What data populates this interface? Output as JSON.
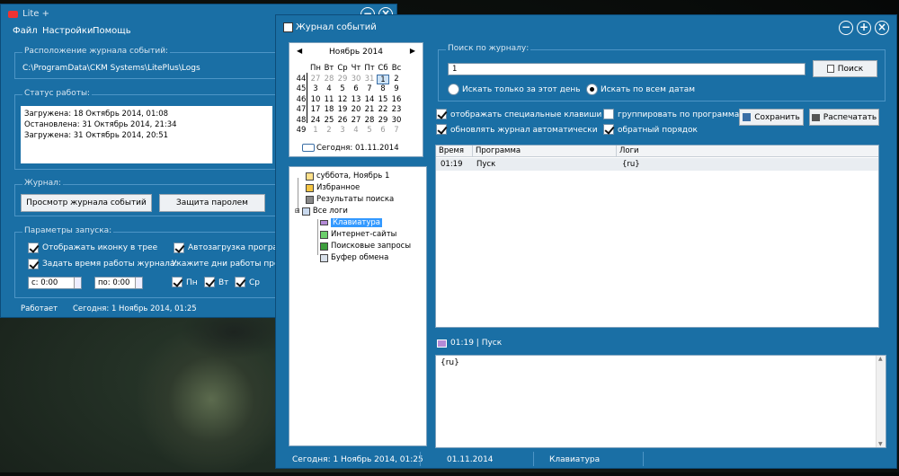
{
  "lite": {
    "title": "Lite +",
    "menu": [
      "Файл",
      "Настройки",
      "Помощь"
    ],
    "log_location_label": "Расположение журнала событий:",
    "log_path": "C:\\ProgramData\\CKM Systems\\LitePlus\\Logs",
    "work_status_label": "Статус работы:",
    "status_lines": [
      "Загружена: 18 Октябрь 2014, 01:08",
      "Остановлена: 31 Октябрь 2014, 21:34",
      "Загружена: 31 Октябрь 2014, 20:51"
    ],
    "journal_label": "Журнал:",
    "view_log_button": "Просмотр журнала событий",
    "password_button": "Защита паролем",
    "launch_params_label": "Параметры запуска:",
    "show_tray_icon": "Отображать иконку в трее",
    "autoload_programs": "Автозагрузка программы",
    "set_journal_time": "Задать время работы журнала:",
    "specify_days": "Укажите дни работы програм",
    "time_from": "с: 0:00",
    "time_to": "по: 0:00",
    "days": [
      "Пн",
      "Вт",
      "Ср"
    ],
    "status_left": "Работает",
    "status_today": "Сегодня: 1 Ноябрь 2014, 01:25"
  },
  "journal": {
    "title": "Журнал событий",
    "calendar": {
      "month": "Ноябрь 2014",
      "weekdays": [
        "Пн",
        "Вт",
        "Ср",
        "Чт",
        "Пт",
        "Сб",
        "Вс"
      ],
      "weeks": [
        "44",
        "45",
        "46",
        "47",
        "48",
        "49"
      ],
      "rows": [
        [
          "27",
          "28",
          "29",
          "30",
          "31",
          "1",
          "2"
        ],
        [
          "3",
          "4",
          "5",
          "6",
          "7",
          "8",
          "9"
        ],
        [
          "10",
          "11",
          "12",
          "13",
          "14",
          "15",
          "16"
        ],
        [
          "17",
          "18",
          "19",
          "20",
          "21",
          "22",
          "23"
        ],
        [
          "24",
          "25",
          "26",
          "27",
          "28",
          "29",
          "30"
        ],
        [
          "1",
          "2",
          "3",
          "4",
          "5",
          "6",
          "7"
        ]
      ],
      "today": "Сегодня: 01.11.2014"
    },
    "tree": {
      "day": "суббота, Ноябрь 1",
      "favorites": "Избранное",
      "search_results": "Результаты поиска",
      "all_logs": "Все логи",
      "keyboard": "Клавиатура",
      "websites": "Интернет-сайты",
      "search_queries": "Поисковые запросы",
      "clipboard": "Буфер обмена"
    },
    "search": {
      "label": "Поиск по журналу:",
      "value": "1",
      "button": "Поиск",
      "radio_this_day": "Искать только за этот день",
      "radio_all_dates": "Искать по всем датам"
    },
    "options": {
      "show_special_keys": "отображать специальные клавиши",
      "auto_refresh": "обновлять журнал автоматически",
      "group_by_program": "группировать по программам",
      "reverse_order": "обратный порядок",
      "save_button": "Сохранить",
      "print_button": "Распечатать"
    },
    "grid": {
      "headers": [
        "Время",
        "Программа",
        "Логи"
      ],
      "rows": [
        [
          "01:19",
          "Пуск",
          "{ru}"
        ]
      ]
    },
    "detail": {
      "header": "01:19 | Пуск",
      "content": "{ru}"
    },
    "status": {
      "today": "Сегодня: 1 Ноябрь 2014, 01:25",
      "date": "01.11.2014",
      "category": "Клавиатура"
    }
  }
}
